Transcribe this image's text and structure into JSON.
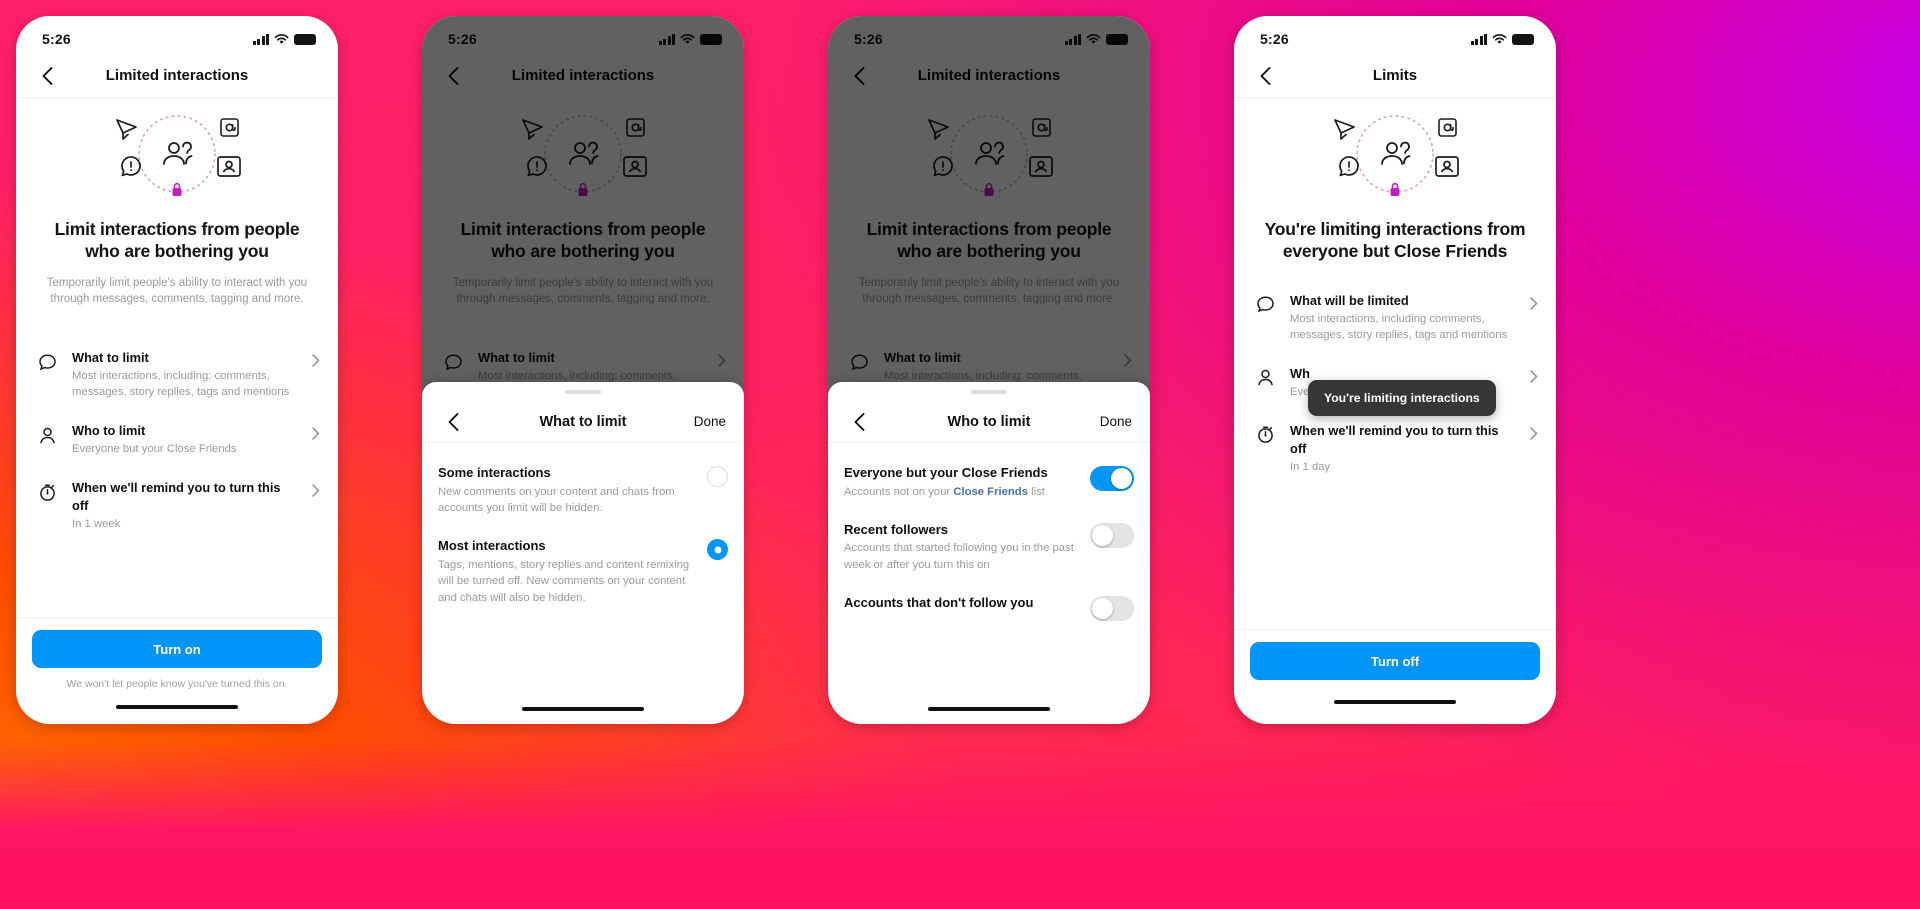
{
  "background": {
    "colors": [
      "#ff7a00",
      "#ff2060",
      "#e0009a",
      "#c400f0"
    ]
  },
  "status_bar": {
    "time": "5:26",
    "signal_icon": "cellular-bars-icon",
    "wifi_icon": "wifi-icon",
    "battery_icon": "battery-full-icon"
  },
  "hero": {
    "icons": [
      "paper-plane-icon",
      "at-sign-icon",
      "comment-alert-icon",
      "contact-card-icon",
      "people-icon",
      "lock-icon"
    ],
    "ring_color": "#d9a0c8",
    "lock_color": "#c020c0"
  },
  "screens": [
    {
      "id": "limited-interactions-setup",
      "nav": {
        "back_icon": "chevron-left-icon",
        "title": "Limited interactions"
      },
      "headline": "Limit interactions from people who are bothering you",
      "subtext": "Temporarily limit people's ability to interact with you through messages, comments, tagging and more.",
      "rows": [
        {
          "icon": "comment-bubble-icon",
          "title": "What to limit",
          "sub": "Most interactions, including: comments, messages, story replies, tags and mentions",
          "chevron": "chevron-right-icon"
        },
        {
          "icon": "person-icon",
          "title": "Who to limit",
          "sub": "Everyone but your Close Friends",
          "chevron": "chevron-right-icon"
        },
        {
          "icon": "stopwatch-icon",
          "title": "When we'll remind you to turn this off",
          "sub": "In 1 week",
          "chevron": "chevron-right-icon"
        }
      ],
      "cta": {
        "label": "Turn on",
        "color": "#0095f6"
      },
      "cta_note": "We won't let people know you've turned this on."
    },
    {
      "id": "what-to-limit-sheet",
      "nav": {
        "back_icon": "chevron-left-icon",
        "title": "Limited interactions"
      },
      "headline": "Limit interactions from people who are bothering you",
      "subtext": "Temporarily limit people's ability to interact with you through messages, comments, tagging and more.",
      "rows": [
        {
          "icon": "comment-bubble-icon",
          "title": "What to limit",
          "sub": "Most interactions, including: comments,",
          "chevron": "chevron-right-icon"
        }
      ],
      "sheet": {
        "back_icon": "chevron-left-icon",
        "title": "What to limit",
        "done_label": "Done",
        "options": [
          {
            "title": "Some interactions",
            "sub": "New comments on your content and chats from accounts you limit will be hidden.",
            "selected": false
          },
          {
            "title": "Most interactions",
            "sub": "Tags, mentions, story replies and content remixing will be turned off. New comments on your content and chats will also be hidden.",
            "selected": true
          }
        ]
      }
    },
    {
      "id": "who-to-limit-sheet",
      "nav": {
        "back_icon": "chevron-left-icon",
        "title": "Limited interactions"
      },
      "headline": "Limit interactions from people who are bothering you",
      "subtext": "Temporarily limit people's ability to interact with you through messages, comments, tagging and more.",
      "rows": [
        {
          "icon": "comment-bubble-icon",
          "title": "What to limit",
          "sub": "Most interactions, including: comments,",
          "chevron": "chevron-right-icon"
        }
      ],
      "sheet": {
        "back_icon": "chevron-left-icon",
        "title": "Who to limit",
        "done_label": "Done",
        "toggles": [
          {
            "title": "Everyone but your Close Friends",
            "sub_before": "Accounts not on your ",
            "sub_link": "Close Friends",
            "sub_after": " list",
            "on": true
          },
          {
            "title": "Recent followers",
            "sub": "Accounts that started following you in the past week or after you turn this on",
            "on": false
          },
          {
            "title": "Accounts that don't follow you",
            "sub": "",
            "on": false
          }
        ]
      }
    },
    {
      "id": "limits-active",
      "nav": {
        "back_icon": "chevron-left-icon",
        "title": "Limits"
      },
      "headline": "You're limiting interactions from everyone but Close Friends",
      "rows": [
        {
          "icon": "comment-bubble-icon",
          "title": "What will be limited",
          "sub": "Most interactions, including comments, messages, story replies, tags and mentions",
          "chevron": "chevron-right-icon"
        },
        {
          "icon": "person-icon",
          "title": "Wh",
          "sub": "Eve",
          "chevron": "chevron-right-icon"
        },
        {
          "icon": "stopwatch-icon",
          "title": "When we'll remind you to turn this off",
          "sub": "In 1 day",
          "chevron": "chevron-right-icon"
        }
      ],
      "tooltip": {
        "text": "You're limiting interactions",
        "bg": "#363636"
      },
      "cta": {
        "label": "Turn off",
        "color": "#0095f6"
      }
    }
  ]
}
